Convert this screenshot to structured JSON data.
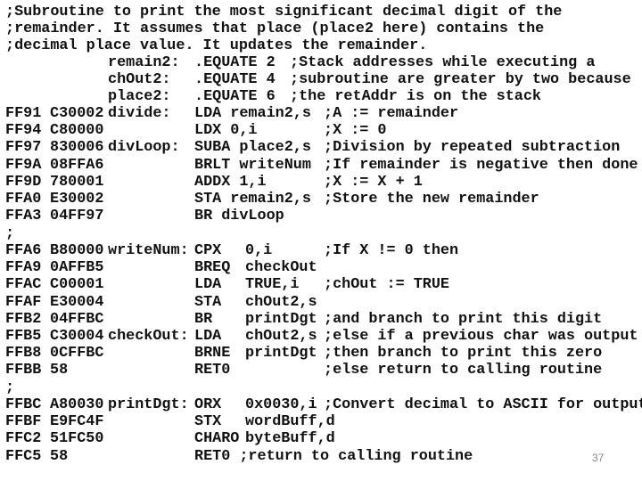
{
  "header_comments": [
    ";Subroutine to print the most significant decimal digit of the",
    ";remainder. It assumes that place (place2 here) contains the",
    ";decimal place value. It updates the remainder."
  ],
  "equates": [
    {
      "label": "remain2:",
      "directive": ".EQUATE 2",
      "comment": ";Stack addresses while executing a"
    },
    {
      "label": "chOut2:",
      "directive": ".EQUATE 4",
      "comment": ";subroutine are greater by two because"
    },
    {
      "label": "place2:",
      "directive": ".EQUATE 6",
      "comment": ";the retAddr is on the stack"
    }
  ],
  "divide_block": [
    {
      "addr": "FF91",
      "obj": "C30002",
      "label": "divide:",
      "mnem": "LDA remain2,s",
      "oper": "",
      "comment": ";A := remainder"
    },
    {
      "addr": "FF94",
      "obj": "C80000",
      "label": "",
      "mnem": "LDX 0,i",
      "oper": "",
      "comment": ";X := 0"
    },
    {
      "addr": "FF97",
      "obj": "830006",
      "label": "divLoop:",
      "mnem": "SUBA place2,s",
      "oper": "",
      "comment": ";Division by repeated subtraction"
    },
    {
      "addr": "FF9A",
      "obj": "08FFA6",
      "label": "",
      "mnem": "BRLT writeNum",
      "oper": "",
      "comment": ";If remainder is negative then done"
    },
    {
      "addr": "FF9D",
      "obj": "780001",
      "label": "",
      "mnem": "ADDX 1,i",
      "oper": "",
      "comment": ";X := X + 1"
    },
    {
      "addr": "FFA0",
      "obj": "E30002",
      "label": "",
      "mnem": "STA remain2,s",
      "oper": "",
      "comment": ";Store the new remainder"
    },
    {
      "addr": "FFA3",
      "obj": "04FF97",
      "label": "",
      "mnem": "BR divLoop",
      "oper": "",
      "comment": ""
    }
  ],
  "separator_1": ";",
  "writenum_block": [
    {
      "addr": "FFA6",
      "obj": "B80000",
      "label": "writeNum:",
      "mnem": "CPX",
      "oper": "0,i",
      "comment": ";If X != 0 then"
    },
    {
      "addr": "FFA9",
      "obj": "0AFFB5",
      "label": "",
      "mnem": "BREQ",
      "oper": "checkOut",
      "comment": ""
    },
    {
      "addr": "FFAC",
      "obj": "C00001",
      "label": "",
      "mnem": "LDA",
      "oper": "TRUE,i",
      "comment": ";chOut := TRUE"
    },
    {
      "addr": "FFAF",
      "obj": "E30004",
      "label": "",
      "mnem": "STA",
      "oper": "chOut2,s",
      "comment": ""
    },
    {
      "addr": "FFB2",
      "obj": "04FFBC",
      "label": "",
      "mnem": "BR",
      "oper": "printDgt",
      "comment": ";and branch to print this digit"
    },
    {
      "addr": "FFB5",
      "obj": "C30004",
      "label": "checkOut:",
      "mnem": "LDA",
      "oper": "chOut2,s",
      "comment": ";else if a previous char was output"
    },
    {
      "addr": "FFB8",
      "obj": "0CFFBC",
      "label": "",
      "mnem": "BRNE",
      "oper": "printDgt",
      "comment": ";then branch to print this zero"
    },
    {
      "addr": "FFBB",
      "obj": "58",
      "label": "",
      "mnem": "RET0",
      "oper": "",
      "comment": ";else return to calling routine"
    }
  ],
  "separator_2": ";",
  "printdgt_block": [
    {
      "addr": "FFBC",
      "obj": "A80030",
      "label": "printDgt:",
      "mnem": "ORX",
      "oper": "0x0030,i",
      "comment": ";Convert decimal to ASCII for output"
    },
    {
      "addr": "FFBF",
      "obj": "E9FC4F",
      "label": "",
      "mnem": "STX",
      "oper": "wordBuff,d",
      "comment": ""
    },
    {
      "addr": "FFC2",
      "obj": "51FC50",
      "label": "",
      "mnem": "CHARO",
      "oper": "byteBuff,d",
      "comment": ""
    },
    {
      "addr": "FFC5",
      "obj": "58",
      "label": "",
      "mnem": "RET0 ;return to calling routine",
      "oper": "",
      "comment": ""
    }
  ],
  "page_number": "37"
}
